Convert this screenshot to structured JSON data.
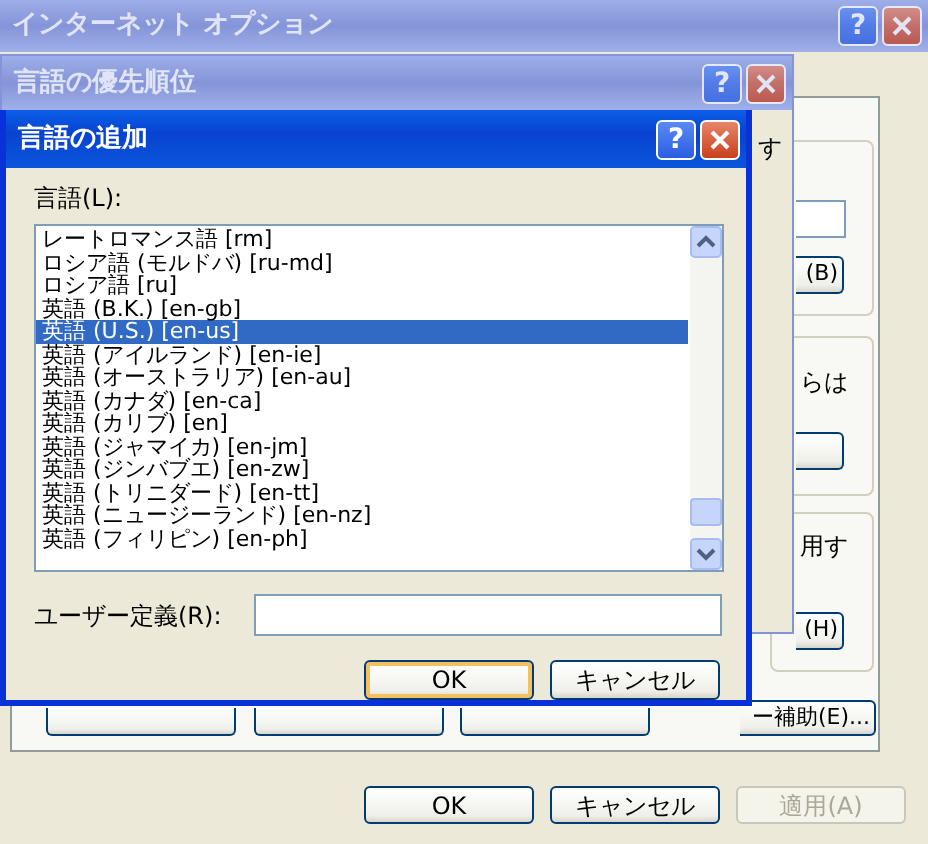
{
  "internet_options": {
    "title": "インターネット オプション",
    "active": false,
    "help": "?",
    "side_texts": [
      {
        "kind": "text",
        "label": "らは"
      },
      {
        "kind": "text",
        "label": "用す"
      }
    ],
    "side_buttons": [
      {
        "kind": "labeled",
        "label": "(B)"
      },
      {
        "kind": "blank"
      },
      {
        "kind": "labeled",
        "label": "(H)"
      }
    ],
    "row_buttons": [
      {
        "kind": "blank"
      },
      {
        "kind": "blank"
      },
      {
        "kind": "blank"
      },
      {
        "kind": "labeled",
        "label": "ー補助(E)..."
      }
    ],
    "buttons": [
      {
        "label": "OK",
        "disabled": false
      },
      {
        "label": "キャンセル",
        "disabled": false
      },
      {
        "label": "適用(A)",
        "disabled": true
      }
    ]
  },
  "language_preference": {
    "title": "言語の優先順位",
    "active": false,
    "help": "?",
    "fragment": "す"
  },
  "add_language": {
    "title": "言語の追加",
    "active": true,
    "help": "?",
    "list_label": "言語(L):",
    "languages": [
      {
        "label": "レートロマンス語 [rm]",
        "selected": false
      },
      {
        "label": "ロシア語 (モルドバ) [ru-md]",
        "selected": false
      },
      {
        "label": "ロシア語 [ru]",
        "selected": false
      },
      {
        "label": "英語 (B.K.) [en-gb]",
        "selected": false
      },
      {
        "label": "英語 (U.S.) [en-us]",
        "selected": true
      },
      {
        "label": "英語 (アイルランド) [en-ie]",
        "selected": false
      },
      {
        "label": "英語 (オーストラリア) [en-au]",
        "selected": false
      },
      {
        "label": "英語 (カナダ) [en-ca]",
        "selected": false
      },
      {
        "label": "英語 (カリブ) [en]",
        "selected": false
      },
      {
        "label": "英語 (ジャマイカ) [en-jm]",
        "selected": false
      },
      {
        "label": "英語 (ジンバブエ) [en-zw]",
        "selected": false
      },
      {
        "label": "英語 (トリニダード) [en-tt]",
        "selected": false
      },
      {
        "label": "英語 (ニュージーランド) [en-nz]",
        "selected": false
      },
      {
        "label": "英語 (フィリピン) [en-ph]",
        "selected": false
      }
    ],
    "custom_label": "ユーザー定義(R):",
    "buttons": [
      {
        "label": "OK",
        "default": true
      },
      {
        "label": "キャンセル",
        "default": false
      }
    ]
  }
}
